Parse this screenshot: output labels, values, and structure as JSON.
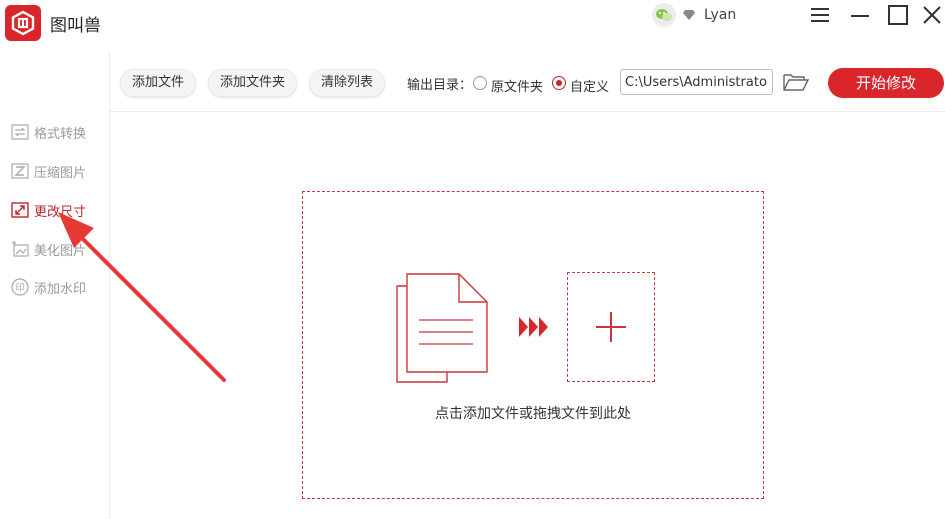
{
  "app": {
    "title": "图叫兽"
  },
  "user": {
    "name": "Lyan"
  },
  "sidebar": {
    "items": [
      {
        "label": "格式转换",
        "icon": "convert-icon",
        "active": false
      },
      {
        "label": "压缩图片",
        "icon": "compress-icon",
        "active": false
      },
      {
        "label": "更改尺寸",
        "icon": "resize-icon",
        "active": true
      },
      {
        "label": "美化图片",
        "icon": "beautify-icon",
        "active": false
      },
      {
        "label": "添加水印",
        "icon": "watermark-icon",
        "active": false
      }
    ]
  },
  "toolbar": {
    "add_file_label": "添加文件",
    "add_folder_label": "添加文件夹",
    "clear_list_label": "清除列表",
    "output_dir_label": "输出目录：",
    "output_options": [
      {
        "label": "原文件夹",
        "selected": false
      },
      {
        "label": "自定义",
        "selected": true
      }
    ],
    "output_path": "C:\\Users\\Administrator\\I",
    "start_label": "开始修改"
  },
  "main": {
    "drop_hint": "点击添加文件或拖拽文件到此处"
  },
  "colors": {
    "accent": "#d8262b",
    "accent_dark": "#c0262c",
    "muted_text": "#9a9a9a"
  }
}
